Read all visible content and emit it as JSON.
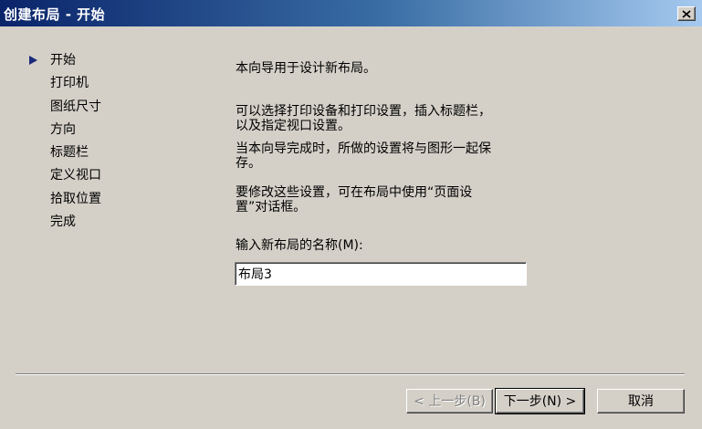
{
  "window": {
    "title": "创建布局 - 开始",
    "close_symbol": "close-x-icon"
  },
  "steps": [
    {
      "label": "开始",
      "current": true
    },
    {
      "label": "打印机",
      "current": false
    },
    {
      "label": "图纸尺寸",
      "current": false
    },
    {
      "label": "方向",
      "current": false
    },
    {
      "label": "标题栏",
      "current": false
    },
    {
      "label": "定义视口",
      "current": false
    },
    {
      "label": "拾取位置",
      "current": false
    },
    {
      "label": "完成",
      "current": false
    }
  ],
  "description": {
    "intro": "本向导用于设计新布局。",
    "para1": [
      "可以选择打印设备和打印设置，插入标题栏，",
      "以及指定视口设置。"
    ],
    "para2": [
      "当本向导完成时，所做的设置将与图形一起保",
      "存。"
    ],
    "para3": [
      "要修改这些设置，可在布局中使用“页面设",
      "置”对话框。"
    ]
  },
  "name_field": {
    "label": "输入新布局的名称(M):",
    "value": "布局3"
  },
  "buttons": {
    "back": "< 上一步(B)",
    "next": "下一步(N) >",
    "cancel": "取消"
  },
  "colors": {
    "titlebar_start": "#0a246a",
    "titlebar_end": "#a6caf0",
    "background": "#d4d0c8",
    "arrow": "#1a2a7a"
  }
}
